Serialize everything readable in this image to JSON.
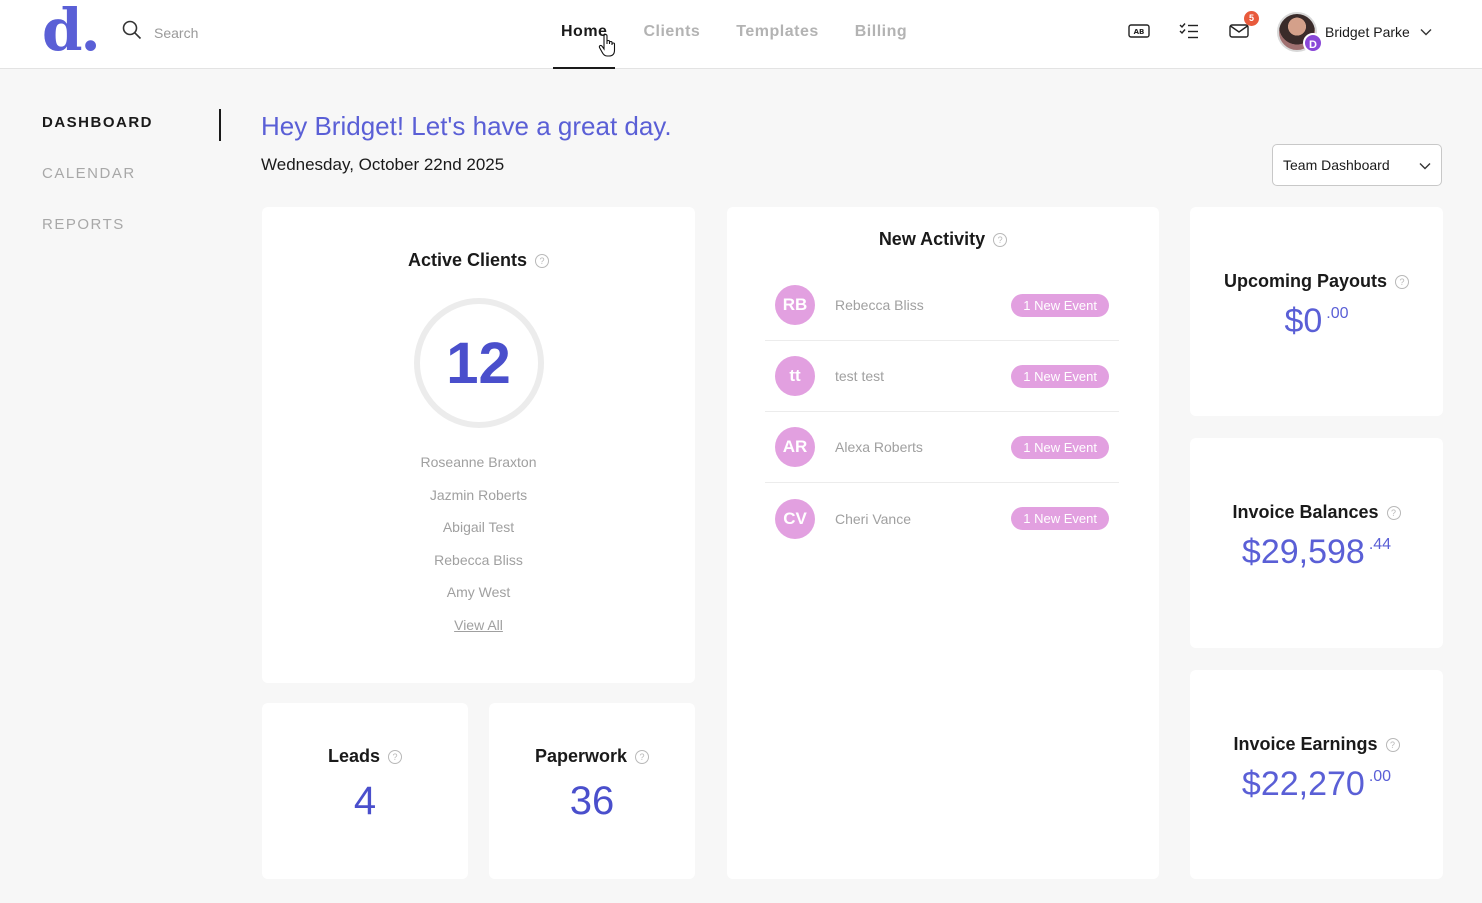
{
  "app": {
    "logo": "d."
  },
  "search": {
    "placeholder": "Search"
  },
  "nav": {
    "items": [
      "Home",
      "Clients",
      "Templates",
      "Billing"
    ],
    "active": "Home"
  },
  "notifications": {
    "mail_count": "5"
  },
  "user": {
    "name": "Bridget Parke",
    "avatar_badge": "D"
  },
  "sidebar": {
    "items": [
      "DASHBOARD",
      "CALENDAR",
      "REPORTS"
    ],
    "active": "DASHBOARD"
  },
  "header": {
    "greeting": "Hey Bridget! Let's have a great day.",
    "date": "Wednesday, October 22nd 2025"
  },
  "dashboard_select": {
    "value": "Team Dashboard"
  },
  "active_clients": {
    "title": "Active Clients",
    "count": "12",
    "clients": [
      "Roseanne Braxton",
      "Jazmin Roberts",
      "Abigail Test",
      "Rebecca Bliss",
      "Amy West"
    ],
    "view_all": "View All"
  },
  "new_activity": {
    "title": "New Activity",
    "rows": [
      {
        "initials": "RB",
        "name": "Rebecca Bliss",
        "pill": "1 New Event"
      },
      {
        "initials": "tt",
        "name": "test test",
        "pill": "1 New Event"
      },
      {
        "initials": "AR",
        "name": "Alexa Roberts",
        "pill": "1 New Event"
      },
      {
        "initials": "CV",
        "name": "Cheri Vance",
        "pill": "1 New Event"
      }
    ]
  },
  "upcoming_payouts": {
    "title": "Upcoming Payouts",
    "whole": "$0",
    "cents": ".00"
  },
  "invoice_balances": {
    "title": "Invoice Balances",
    "whole": "$29,598",
    "cents": ".44"
  },
  "invoice_earnings": {
    "title": "Invoice Earnings",
    "whole": "$22,270",
    "cents": ".00"
  },
  "leads": {
    "title": "Leads",
    "value": "4"
  },
  "paperwork": {
    "title": "Paperwork",
    "value": "36"
  },
  "colors": {
    "accent": "#5a5fd6",
    "pill": "#e2a0e0",
    "badge": "#e85a3c"
  }
}
